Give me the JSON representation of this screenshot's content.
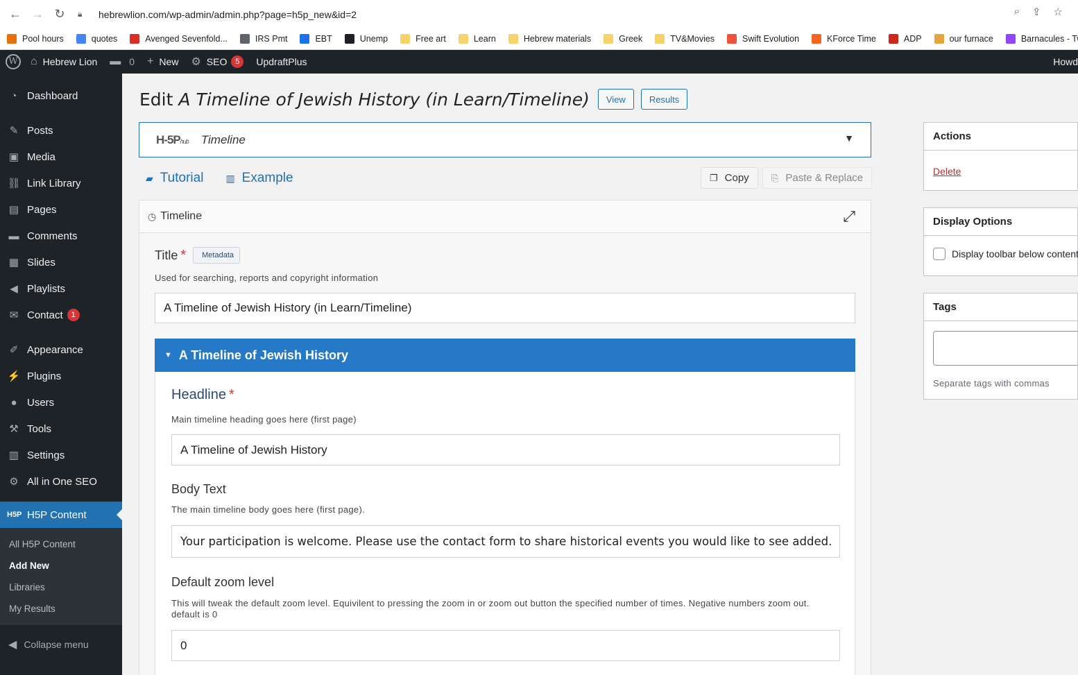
{
  "browser": {
    "url": "hebrewlion.com/wp-admin/admin.php?page=h5p_new&id=2",
    "bookmarks": [
      {
        "label": "Pool hours",
        "color": "#e8710a"
      },
      {
        "label": "quotes",
        "color": "#4285f4"
      },
      {
        "label": "Avenged Sevenfold...",
        "color": "#d93025"
      },
      {
        "label": "IRS Pmt",
        "color": "#5f6368"
      },
      {
        "label": "EBT",
        "color": "#1a73e8"
      },
      {
        "label": "Unemp",
        "color": "#202124"
      },
      {
        "label": "Free art",
        "color": "#f6d36b"
      },
      {
        "label": "Learn",
        "color": "#f6d36b"
      },
      {
        "label": "Hebrew materials",
        "color": "#f6d36b"
      },
      {
        "label": "Greek",
        "color": "#f6d36b"
      },
      {
        "label": "TV&Movies",
        "color": "#f6d36b"
      },
      {
        "label": "Swift Evolution",
        "color": "#f05138"
      },
      {
        "label": "KForce Time",
        "color": "#f26522"
      },
      {
        "label": "ADP",
        "color": "#d0271d"
      },
      {
        "label": "our furnace",
        "color": "#e8a33d"
      },
      {
        "label": "Barnacules - Twitch",
        "color": "#9146ff"
      }
    ]
  },
  "adminbar": {
    "site": "Hebrew Lion",
    "comments_count": "0",
    "new_label": "New",
    "seo_label": "SEO",
    "seo_badge": "5",
    "updraft": "UpdraftPlus",
    "howdy": "Howd"
  },
  "sidebar": {
    "items": [
      {
        "label": "Dashboard",
        "icon": "dashboard-icon",
        "glyph": "◔"
      },
      {
        "label": "Posts",
        "icon": "pin-icon",
        "glyph": "✎"
      },
      {
        "label": "Media",
        "icon": "media-icon",
        "glyph": "▣"
      },
      {
        "label": "Link Library",
        "icon": "link-icon",
        "glyph": "⛓"
      },
      {
        "label": "Pages",
        "icon": "pages-icon",
        "glyph": "▤"
      },
      {
        "label": "Comments",
        "icon": "comment-icon",
        "glyph": "▬"
      },
      {
        "label": "Slides",
        "icon": "slides-icon",
        "glyph": "▦"
      },
      {
        "label": "Playlists",
        "icon": "audio-icon",
        "glyph": "◀"
      },
      {
        "label": "Contact",
        "icon": "mail-icon",
        "glyph": "✉",
        "badge": "1"
      },
      {
        "label": "Appearance",
        "icon": "brush-icon",
        "glyph": "✐"
      },
      {
        "label": "Plugins",
        "icon": "plug-icon",
        "glyph": "⚡"
      },
      {
        "label": "Users",
        "icon": "user-icon",
        "glyph": "●"
      },
      {
        "label": "Tools",
        "icon": "wrench-icon",
        "glyph": "⚒"
      },
      {
        "label": "Settings",
        "icon": "settings-icon",
        "glyph": "▥"
      },
      {
        "label": "All in One SEO",
        "icon": "aioseo-icon",
        "glyph": "⚙"
      }
    ],
    "active": {
      "label": "H5P Content",
      "icon": "h5p-icon"
    },
    "submenu": [
      "All H5P Content",
      "Add New",
      "Libraries",
      "My Results"
    ],
    "collapse": "Collapse menu"
  },
  "main": {
    "title_prefix": "Edit",
    "title_name": "A Timeline of Jewish History (in Learn/Timeline)",
    "view_btn": "View",
    "results_btn": "Results",
    "hub_logo": "H-5P",
    "hub_logo_sub": "hub",
    "hub_content_type": "Timeline",
    "tutorial": "Tutorial",
    "example": "Example",
    "copy": "Copy",
    "paste": "Paste & Replace",
    "editor_title": "Timeline",
    "title_field": {
      "label": "Title",
      "metadata": "Metadata",
      "desc": "Used for searching, reports and copyright information",
      "value": "A Timeline of Jewish History (in Learn/Timeline)"
    },
    "group_title": "A Timeline of Jewish History",
    "headline": {
      "label": "Headline",
      "desc": "Main timeline heading goes here (first page)",
      "value": "A Timeline of Jewish History"
    },
    "body_text": {
      "label": "Body Text",
      "desc": "The main timeline body goes here (first page).",
      "value": "Your participation is welcome. Please use the contact form to share historical events you would like to see added."
    },
    "zoom": {
      "label": "Default zoom level",
      "desc": "This will tweak the default zoom level. Equivilent to pressing the zoom in or zoom out button the specified number of times. Negative numbers zoom out. default is 0",
      "value": "0"
    }
  },
  "right": {
    "actions_title": "Actions",
    "delete": "Delete",
    "display_title": "Display Options",
    "display_toolbar": "Display toolbar below content",
    "tags_title": "Tags",
    "tags_hint": "Separate tags with commas"
  }
}
